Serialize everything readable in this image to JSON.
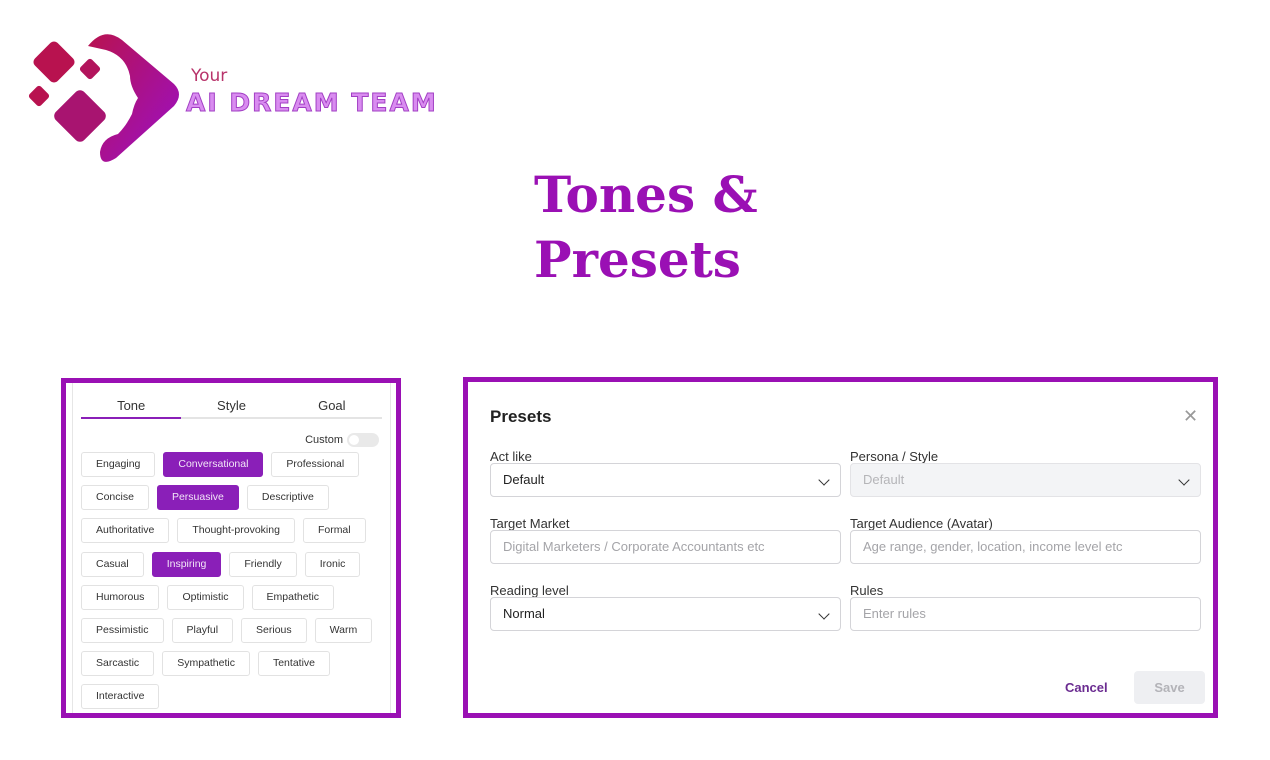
{
  "logo": {
    "line1": "Your",
    "line2": "AI DREAM TEAM"
  },
  "title": {
    "line1": "Tones &",
    "line2": "Presets"
  },
  "tone_panel": {
    "tabs": [
      {
        "label": "Tone",
        "active": true
      },
      {
        "label": "Style"
      },
      {
        "label": "Goal"
      }
    ],
    "custom_label": "Custom",
    "custom_on": false,
    "accent": "#8a1fb8",
    "rows": [
      [
        {
          "label": "Engaging"
        },
        {
          "label": "Conversational",
          "selected": true
        },
        {
          "label": "Professional"
        }
      ],
      [
        {
          "label": "Concise"
        },
        {
          "label": "Persuasive",
          "selected": true
        },
        {
          "label": "Descriptive"
        }
      ],
      [
        {
          "label": "Authoritative"
        },
        {
          "label": "Thought-provoking"
        },
        {
          "label": "Formal"
        }
      ],
      [
        {
          "label": "Casual"
        },
        {
          "label": "Inspiring",
          "selected": true
        },
        {
          "label": "Friendly"
        },
        {
          "label": "Ironic"
        }
      ],
      [
        {
          "label": "Humorous"
        },
        {
          "label": "Optimistic"
        },
        {
          "label": "Empathetic"
        }
      ],
      [
        {
          "label": "Pessimistic"
        },
        {
          "label": "Playful"
        },
        {
          "label": "Serious"
        },
        {
          "label": "Warm"
        }
      ],
      [
        {
          "label": "Sarcastic"
        },
        {
          "label": "Sympathetic"
        },
        {
          "label": "Tentative"
        }
      ],
      [
        {
          "label": "Interactive"
        }
      ]
    ]
  },
  "presets": {
    "title": "Presets",
    "close_icon": "close-icon",
    "act_like": {
      "label": "Act like",
      "value": "Default"
    },
    "persona": {
      "label": "Persona / Style",
      "value": "Default",
      "disabled": true
    },
    "target_market": {
      "label": "Target Market",
      "placeholder": "Digital Marketers / Corporate Accountants etc"
    },
    "target_audience": {
      "label": "Target Audience (Avatar)",
      "placeholder": "Age range, gender, location, income level etc"
    },
    "reading_level": {
      "label": "Reading level",
      "value": "Normal"
    },
    "rules": {
      "label": "Rules",
      "placeholder": "Enter rules"
    },
    "cancel_label": "Cancel",
    "save_label": "Save"
  }
}
